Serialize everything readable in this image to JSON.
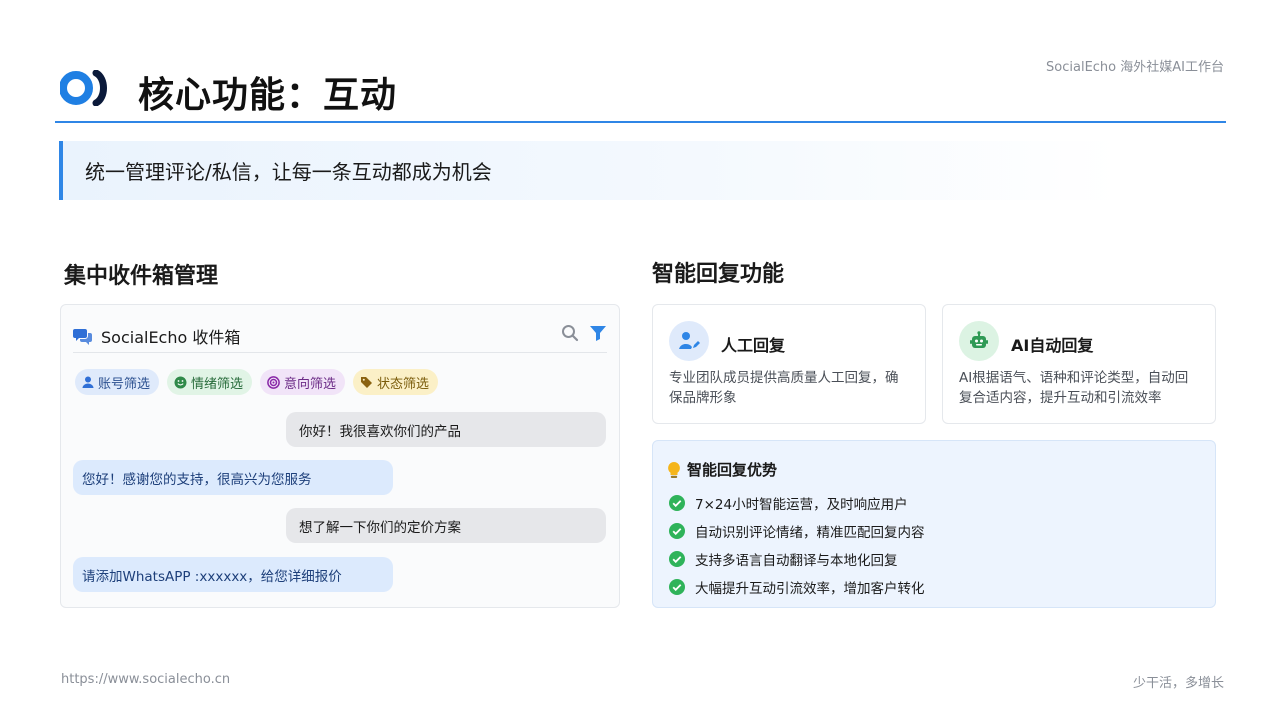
{
  "header": {
    "brand_tag": "SocialEcho 海外社媒AI工作台",
    "title": "核心功能：互动",
    "accent_color": "#2f86e6"
  },
  "subtitle": "统一管理评论/私信，让每一条互动都成为机会",
  "left_section": {
    "title": "集中收件箱管理",
    "inbox": {
      "title": "SocialEcho 收件箱",
      "icons": [
        "chat-bubbles-icon",
        "search-icon",
        "filter-icon"
      ],
      "chips": [
        {
          "label": "账号筛选",
          "icon": "user-icon"
        },
        {
          "label": "情绪筛选",
          "icon": "smile-icon"
        },
        {
          "label": "意向筛选",
          "icon": "target-icon"
        },
        {
          "label": "状态筛选",
          "icon": "tag-icon"
        }
      ],
      "messages": [
        {
          "side": "incoming",
          "text": "你好！我很喜欢你们的产品"
        },
        {
          "side": "outgoing",
          "text": "您好！感谢您的支持，很高兴为您服务"
        },
        {
          "side": "incoming",
          "text": "想了解一下你们的定价方案"
        },
        {
          "side": "outgoing",
          "text": "请添加WhatsAPP :xxxxxx，给您详细报价"
        }
      ]
    }
  },
  "right_section": {
    "title": "智能回复功能",
    "cards": [
      {
        "title": "人工回复",
        "icon": "user-edit-icon",
        "desc": "专业团队成员提供高质量人工回复，确保品牌形象"
      },
      {
        "title": "AI自动回复",
        "icon": "robot-icon",
        "desc": "AI根据语气、语种和评论类型，自动回复合适内容，提升互动和引流效率"
      }
    ],
    "advantages": {
      "title": "智能回复优势",
      "icon": "lightbulb-icon",
      "items": [
        "7×24小时智能运营，及时响应用户",
        "自动识别评论情绪，精准匹配回复内容",
        "支持多语言自动翻译与本地化回复",
        "大幅提升互动引流效率，增加客户转化"
      ]
    }
  },
  "footer": {
    "url": "https://www.socialecho.cn",
    "slogan": "少干活，多增长"
  }
}
